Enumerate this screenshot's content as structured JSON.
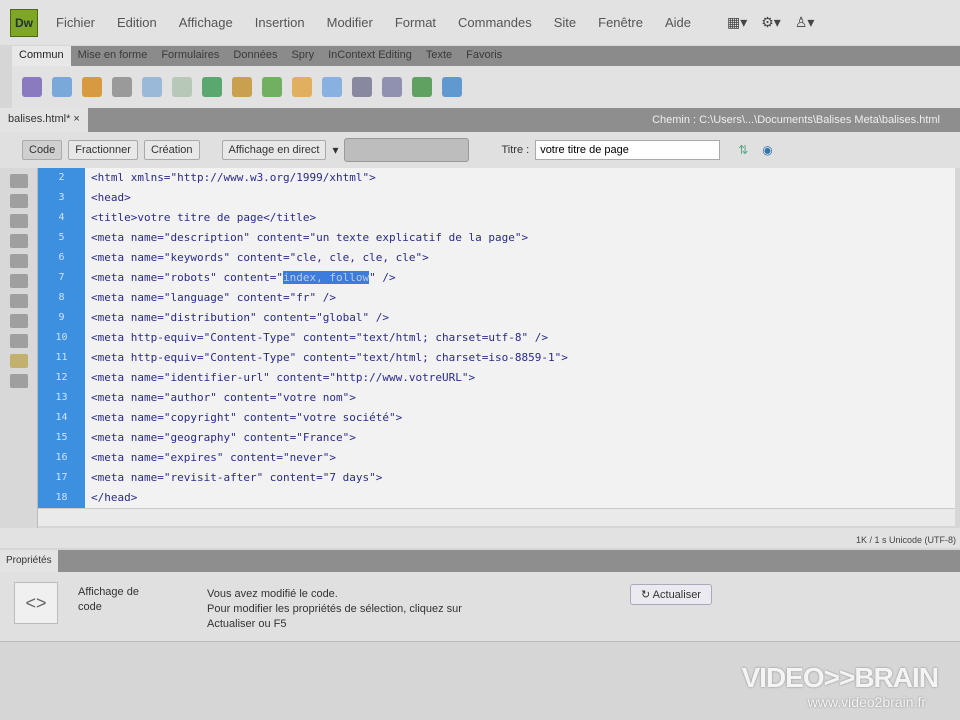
{
  "app": {
    "logo": "Dw"
  },
  "menu": [
    "Fichier",
    "Edition",
    "Affichage",
    "Insertion",
    "Modifier",
    "Format",
    "Commandes",
    "Site",
    "Fenêtre",
    "Aide"
  ],
  "menu_right_icons": [
    "layout-icon",
    "gear-icon",
    "user-icon"
  ],
  "insert_tabs": [
    "Commun",
    "Mise en forme",
    "Formulaires",
    "Données",
    "Spry",
    "InContext Editing",
    "Texte",
    "Favoris"
  ],
  "document": {
    "tab": "balises.html*",
    "path": "Chemin : C:\\Users\\...\\Documents\\Balises Meta\\balises.html"
  },
  "doc_toolbar": {
    "code": "Code",
    "split": "Fractionner",
    "design": "Création",
    "live": "Affichage en direct",
    "title_label": "Titre :",
    "title_value": "votre titre de page"
  },
  "code": {
    "line_numbers": [
      "2",
      "3",
      "4",
      "5",
      "6",
      "7",
      "8",
      "9",
      "10",
      "11",
      "12",
      "13",
      "14",
      "15",
      "16",
      "17",
      "18"
    ],
    "lines": [
      "<html xmlns=\"http://www.w3.org/1999/xhtml\">",
      "<head>",
      "<title>votre titre de page</title>",
      "<meta name=\"description\" content=\"un texte explicatif de la page\">",
      "<meta name=\"keywords\" content=\"cle, cle, cle, cle\">",
      "<meta name=\"robots\" content=\"",
      "<meta name=\"language\" content=\"fr\" />",
      "<meta name=\"distribution\" content=\"global\" />",
      "<meta http-equiv=\"Content-Type\" content=\"text/html; charset=utf-8\" />",
      "<meta http-equiv=\"Content-Type\" content=\"text/html; charset=iso-8859-1\">",
      "<meta name=\"identifier-url\" content=\"http://www.votreURL\">",
      "<meta name=\"author\" content=\"votre nom\">",
      "<meta name=\"copyright\" content=\"votre société\">",
      "<meta name=\"geography\" content=\"France\">",
      "<meta name=\"expires\" content=\"never\">",
      "<meta name=\"revisit-after\" content=\"7 days\">",
      "</head>"
    ],
    "selected_text": "index, follow",
    "after_selection": "\" />"
  },
  "status": "1K / 1 s  Unicode (UTF-8)",
  "properties": {
    "tab": "Propriétés",
    "label": "Affichage de code",
    "message": [
      "Vous avez modifié le code.",
      "Pour modifier les propriétés de sélection, cliquez sur",
      "Actualiser ou F5"
    ],
    "refresh": "Actualiser"
  },
  "watermark": {
    "brand": "VIDEO>>BRAIN",
    "url": "www.video2brain.fr"
  }
}
